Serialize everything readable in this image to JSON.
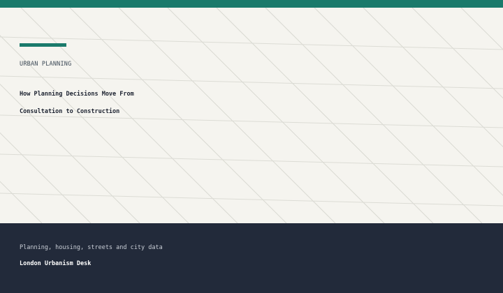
{
  "colors": {
    "accent": "#1a7a6b",
    "footer_bg": "#222a3a",
    "hero_bg": "#f5f4ef"
  },
  "hero": {
    "eyebrow": "URBAN PLANNING",
    "headline_line1": "How Planning Decisions Move From",
    "headline_line2": "Consultation to Construction"
  },
  "footer": {
    "tagline": "Planning, housing, streets and city data",
    "brand": "London Urbanism Desk"
  }
}
